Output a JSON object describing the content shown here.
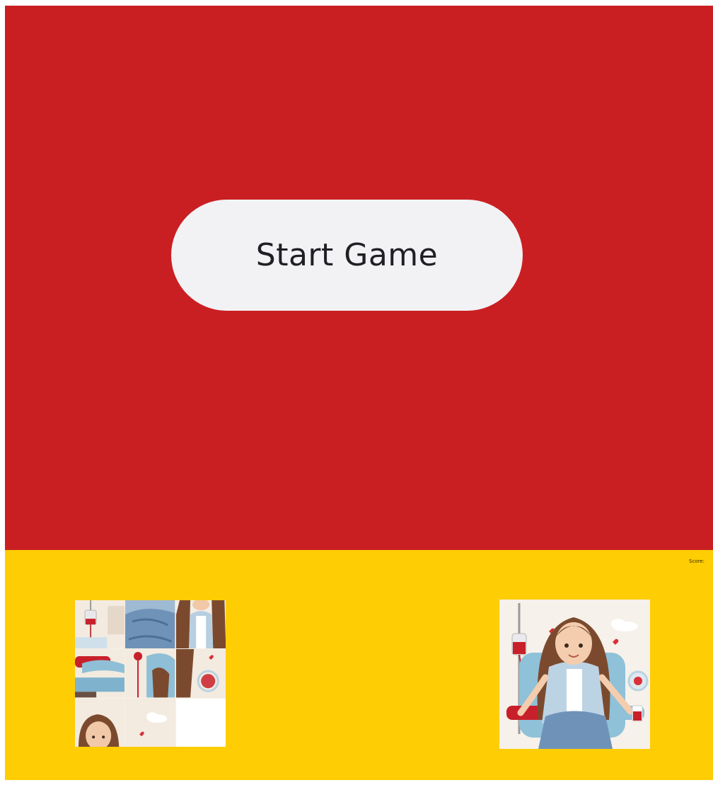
{
  "start_screen": {
    "start_button_label": "Start Game"
  },
  "footer": {
    "score_label": "Score: "
  },
  "puzzle": {
    "grid_size": "3x3",
    "tiles": [
      {
        "name": "tile-1",
        "icon": "iv-bag-tile"
      },
      {
        "name": "tile-2",
        "icon": "jeans-tile"
      },
      {
        "name": "tile-3",
        "icon": "hair-jacket-tile"
      },
      {
        "name": "tile-4",
        "icon": "armrest-tile"
      },
      {
        "name": "tile-5",
        "icon": "tube-knee-tile"
      },
      {
        "name": "tile-6",
        "icon": "hair-heart-tile"
      },
      {
        "name": "tile-7",
        "icon": "face-tile"
      },
      {
        "name": "tile-8",
        "icon": "cloud-heart-tile"
      },
      {
        "name": "tile-9",
        "icon": "empty-tile"
      }
    ]
  },
  "reference_image": {
    "icon": "blood-donor-woman-illustration"
  },
  "colors": {
    "top_panel": "#ca1f22",
    "bottom_panel": "#fecd04",
    "button_bg": "#f2f2f5",
    "button_text": "#1f1f24"
  }
}
